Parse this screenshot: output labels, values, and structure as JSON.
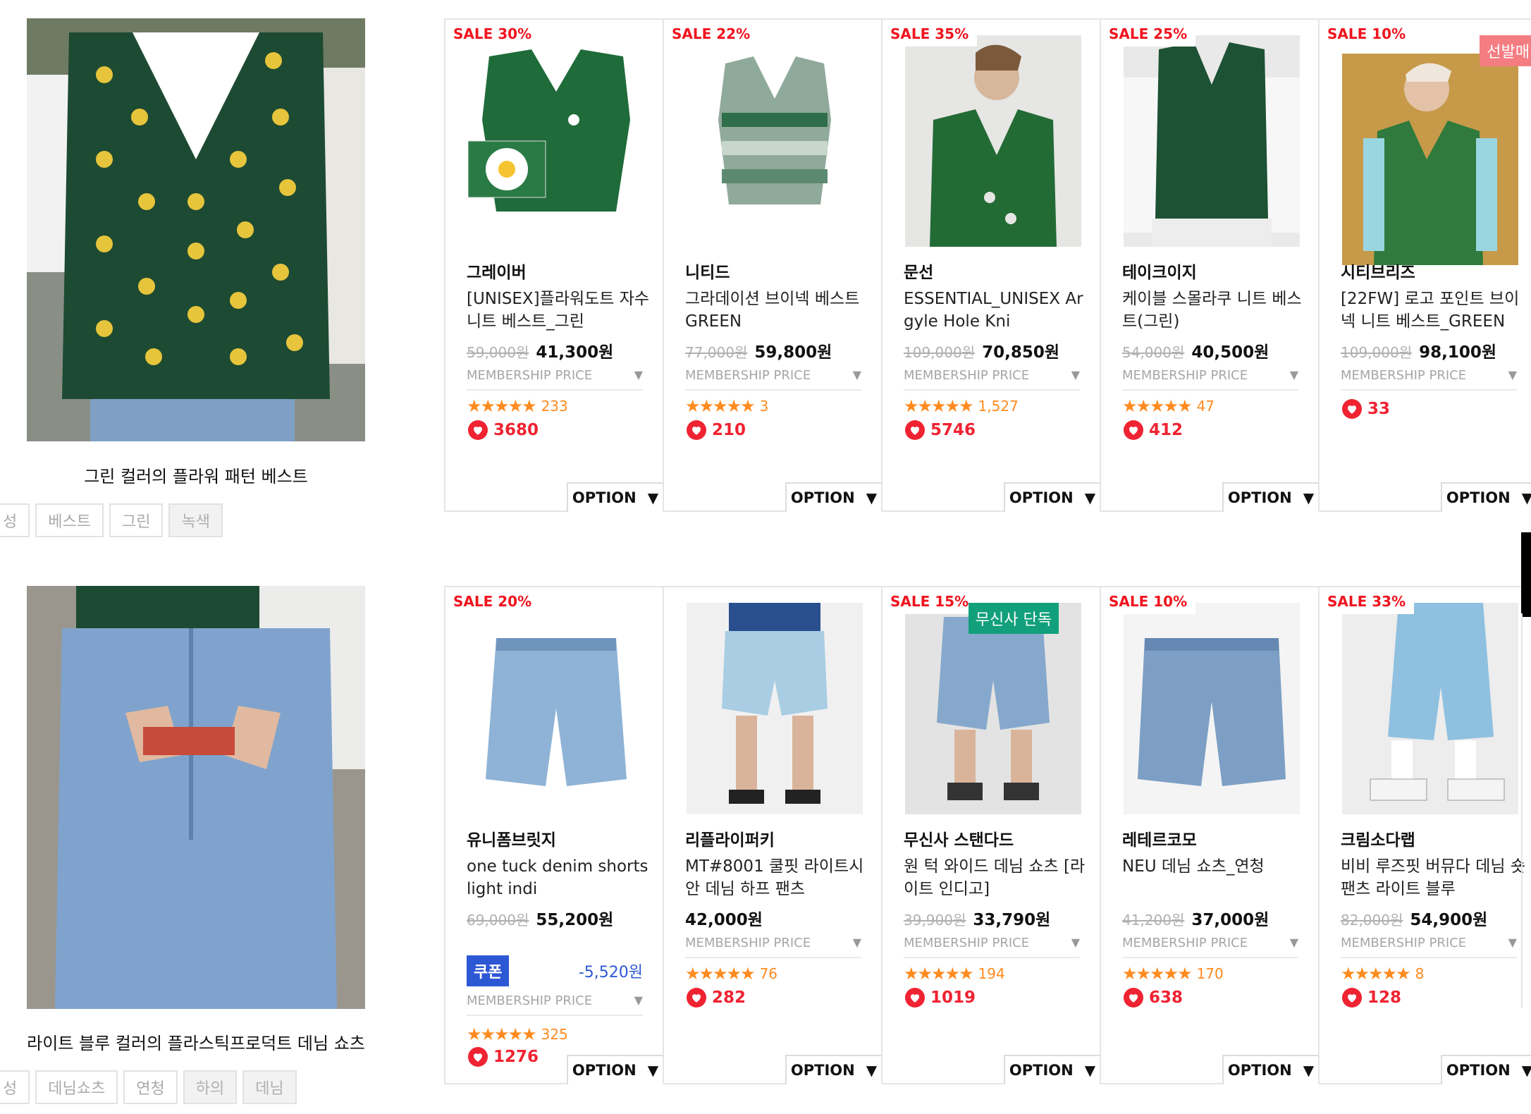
{
  "looks": [
    {
      "caption": "그린 컬러의 플라워 패턴 베스트",
      "tags": [
        "성",
        "베스트",
        "그린",
        "녹색"
      ]
    },
    {
      "caption": "라이트 블루 컬러의 플라스틱프로덕트 데님 쇼츠",
      "tags": [
        "성",
        "데님쇼츠",
        "연청",
        "하의",
        "데님"
      ]
    }
  ],
  "row1": [
    {
      "sale": "SALE 30%",
      "brand": "그레이버",
      "name": "[UNISEX]플라워도트 자수 니트 베스트_그린",
      "old_price": "59,000원",
      "price": "41,300원",
      "membership": "MEMBERSHIP PRICE",
      "stars": "★★★★★",
      "reviews": "233",
      "likes": "3680",
      "option": "OPTION"
    },
    {
      "sale": "SALE 22%",
      "brand": "니티드",
      "name": "그라데이션 브이넥 베스트 GREEN",
      "old_price": "77,000원",
      "price": "59,800원",
      "membership": "MEMBERSHIP PRICE",
      "stars": "★★★★★",
      "reviews": "3",
      "likes": "210",
      "option": "OPTION"
    },
    {
      "sale": "SALE 35%",
      "brand": "문선",
      "name": "ESSENTIAL_UNISEX Argyle Hole Kni",
      "old_price": "109,000원",
      "price": "70,850원",
      "membership": "MEMBERSHIP PRICE",
      "stars": "★★★★★",
      "reviews": "1,527",
      "likes": "5746",
      "option": "OPTION"
    },
    {
      "sale": "SALE 25%",
      "brand": "테이크이지",
      "name": "케이블 스몰라쿠 니트 베스트(그린)",
      "old_price": "54,000원",
      "price": "40,500원",
      "membership": "MEMBERSHIP PRICE",
      "stars": "★★★★★",
      "reviews": "47",
      "likes": "412",
      "option": "OPTION"
    },
    {
      "sale": "SALE 10%",
      "flag": "선발매",
      "brand": "시티브리즈",
      "name": "[22FW] 로고 포인트 브이넥 니트 베스트_GREEN",
      "old_price": "109,000원",
      "price": "98,100원",
      "membership": "MEMBERSHIP PRICE",
      "likes": "33",
      "option": "OPTION"
    }
  ],
  "row2": [
    {
      "sale": "SALE 20%",
      "brand": "유니폼브릿지",
      "name": "one tuck denim shorts light indi",
      "old_price": "69,000원",
      "price": "55,200원",
      "coupon": "쿠폰",
      "coupon_amount": "-5,520원",
      "membership": "MEMBERSHIP PRICE",
      "stars": "★★★★★",
      "reviews": "325",
      "likes": "1276",
      "option": "OPTION"
    },
    {
      "brand": "리플라이퍼키",
      "name": "MT#8001 쿨핏 라이트시안 데님 하프 팬츠",
      "price": "42,000원",
      "membership": "MEMBERSHIP PRICE",
      "stars": "★★★★★",
      "reviews": "76",
      "likes": "282",
      "option": "OPTION"
    },
    {
      "sale": "SALE 15%",
      "flag": "무신사 단독",
      "brand": "무신사 스탠다드",
      "name": "원 턱 와이드 데님 쇼츠 [라이트 인디고]",
      "old_price": "39,900원",
      "price": "33,790원",
      "membership": "MEMBERSHIP PRICE",
      "stars": "★★★★★",
      "reviews": "194",
      "likes": "1019",
      "option": "OPTION"
    },
    {
      "sale": "SALE 10%",
      "brand": "레테르코모",
      "name": "NEU 데님 쇼츠_연청",
      "old_price": "41,200원",
      "price": "37,000원",
      "membership": "MEMBERSHIP PRICE",
      "stars": "★★★★★",
      "reviews": "170",
      "likes": "638",
      "option": "OPTION"
    },
    {
      "sale": "SALE 33%",
      "brand": "크림소다랩",
      "name": "비비 루즈핏 버뮤다 데님 숏팬츠 라이트 블루",
      "old_price": "82,000원",
      "price": "54,900원",
      "membership": "MEMBERSHIP PRICE",
      "stars": "★★★★★",
      "reviews": "8",
      "likes": "128",
      "option": "OPTION"
    }
  ]
}
